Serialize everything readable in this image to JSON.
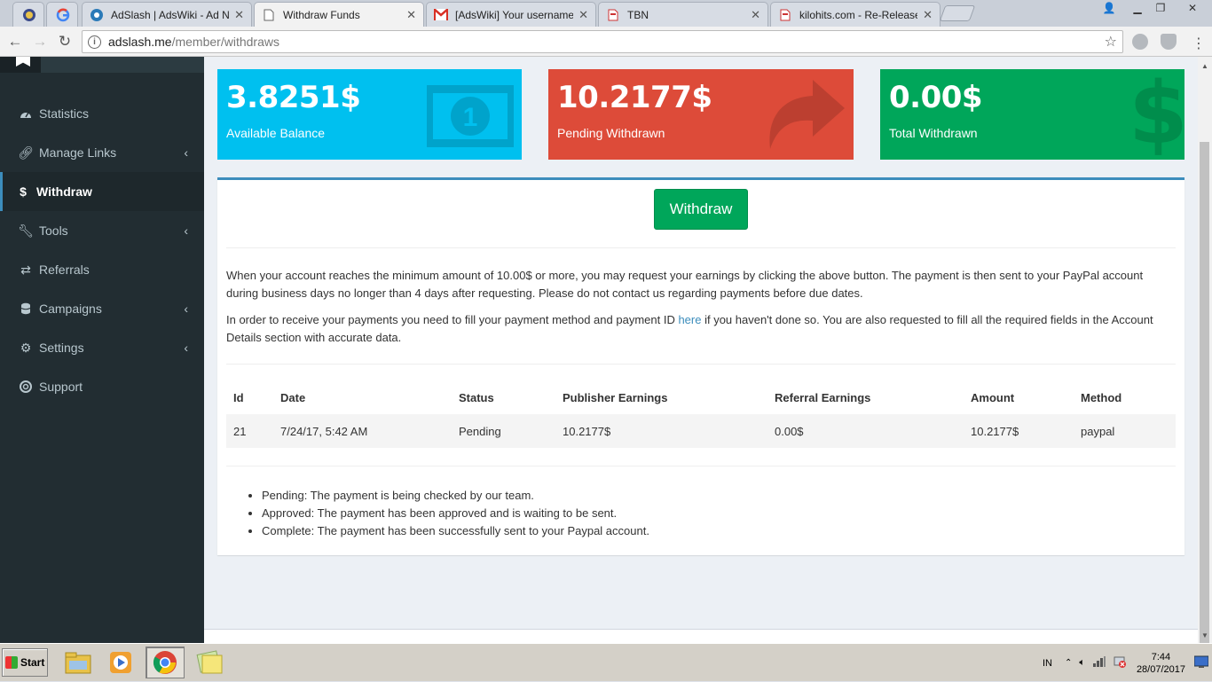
{
  "browser": {
    "tabs": [
      {
        "title": "",
        "icon": "app-icon"
      },
      {
        "title": "",
        "icon": "google-icon"
      },
      {
        "title": "AdSlash | AdsWiki - Ad Net",
        "icon": "adslash-icon"
      },
      {
        "title": "Withdraw Funds",
        "icon": "page-icon",
        "active": true
      },
      {
        "title": "[AdsWiki] Your username a",
        "icon": "gmail-icon"
      },
      {
        "title": "TBN",
        "icon": "page-red-icon"
      },
      {
        "title": "kilohits.com - Re-Release w",
        "icon": "page-red-icon"
      }
    ],
    "url_host": "adslash.me",
    "url_path": "/member/withdraws"
  },
  "sidebar": {
    "items": [
      {
        "label": "Statistics",
        "icon": "dashboard-icon",
        "has_submenu": false
      },
      {
        "label": "Manage Links",
        "icon": "link-icon",
        "has_submenu": true
      },
      {
        "label": "Withdraw",
        "icon": "dollar-icon",
        "has_submenu": false,
        "active": true
      },
      {
        "label": "Tools",
        "icon": "wrench-icon",
        "has_submenu": true
      },
      {
        "label": "Referrals",
        "icon": "exchange-icon",
        "has_submenu": false
      },
      {
        "label": "Campaigns",
        "icon": "database-icon",
        "has_submenu": true
      },
      {
        "label": "Settings",
        "icon": "gears-icon",
        "has_submenu": true
      },
      {
        "label": "Support",
        "icon": "life-ring-icon",
        "has_submenu": false
      }
    ]
  },
  "stats": [
    {
      "value": "3.8251$",
      "label": "Available Balance",
      "color": "#00c0ef",
      "icon": "money-icon"
    },
    {
      "value": "10.2177$",
      "label": "Pending Withdrawn",
      "color": "#dd4b39",
      "icon": "share-arrow-icon"
    },
    {
      "value": "0.00$",
      "label": "Total Withdrawn",
      "color": "#00a65a",
      "icon": "dollar-sign-icon"
    }
  ],
  "withdraw_button": "Withdraw",
  "info": {
    "p1": "When your account reaches the minimum amount of 10.00$ or more, you may request your earnings by clicking the above button. The payment is then sent to your PayPal account during business days no longer than 4 days after requesting. Please do not contact us regarding payments before due dates.",
    "p2_before": "In order to receive your payments you need to fill your payment method and payment ID ",
    "p2_link": "here",
    "p2_after": " if you haven't done so. You are also requested to fill all the required fields in the Account Details section with accurate data."
  },
  "table": {
    "headers": [
      "Id",
      "Date",
      "Status",
      "Publisher Earnings",
      "Referral Earnings",
      "Amount",
      "Method"
    ],
    "rows": [
      [
        "21",
        "7/24/17, 5:42 AM",
        "Pending",
        "10.2177$",
        "0.00$",
        "10.2177$",
        "paypal"
      ]
    ]
  },
  "legend": [
    "Pending: The payment is being checked by our team.",
    "Approved: The payment has been approved and is waiting to be sent.",
    "Complete: The payment has been successfully sent to your Paypal account."
  ],
  "taskbar": {
    "start_label": "Start",
    "language": "IN",
    "time": "7:44",
    "date": "28/07/2017"
  }
}
